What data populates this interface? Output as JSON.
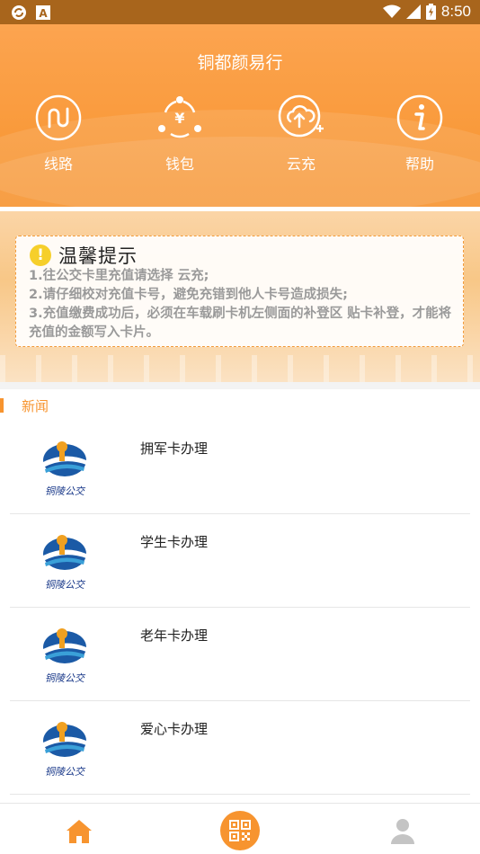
{
  "status_bar": {
    "time": "8:50",
    "notification_icons": [
      "sync-icon",
      "a-box-icon"
    ],
    "system_icons": [
      "wifi-icon",
      "signal-icon",
      "battery-icon"
    ]
  },
  "header": {
    "title": "铜都颜易行",
    "quick_actions": [
      {
        "label": "线路",
        "icon": "route-icon"
      },
      {
        "label": "钱包",
        "icon": "wallet-icon"
      },
      {
        "label": "云充",
        "icon": "cloud-recharge-icon"
      },
      {
        "label": "帮助",
        "icon": "help-icon"
      }
    ]
  },
  "notice": {
    "title": "温馨提示",
    "lines": [
      "1.往公交卡里充值请选择 云充;",
      "2.请仔细校对充值卡号，避免充错到他人卡号造成损失;",
      "3.充值缴费成功后，必须在车载刷卡机左侧面的补登区 贴卡补登，才能将充值的金额写入卡片。"
    ]
  },
  "news": {
    "section_title": "新闻",
    "items": [
      {
        "title": "拥军卡办理"
      },
      {
        "title": "学生卡办理"
      },
      {
        "title": "老年卡办理"
      },
      {
        "title": "爱心卡办理"
      }
    ]
  },
  "bottom_nav": [
    {
      "icon": "home-icon"
    },
    {
      "icon": "qr-code-icon"
    },
    {
      "icon": "user-icon"
    }
  ],
  "colors": {
    "accent": "#f7942f",
    "status_bar": "#a8651c",
    "notice_border": "#f29a3a",
    "warning": "#f6cf2b"
  }
}
